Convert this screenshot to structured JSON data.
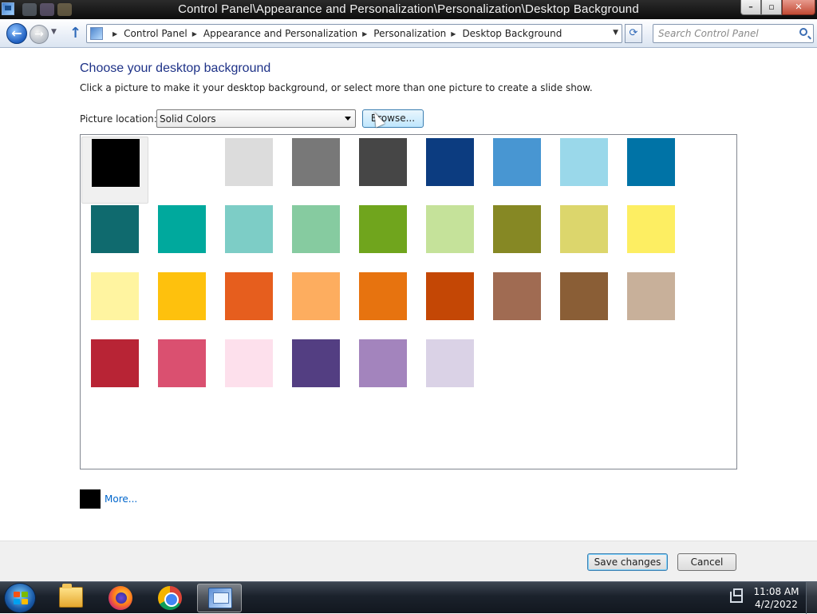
{
  "window": {
    "title": "Control Panel\\Appearance and Personalization\\Personalization\\Desktop Background",
    "controls": {
      "minimize": "–",
      "maximize": "▫",
      "close": "✕"
    }
  },
  "navbar": {
    "back_icon": "back-arrow-icon",
    "forward_icon": "forward-arrow-icon",
    "breadcrumbs": [
      "Control Panel",
      "Appearance and Personalization",
      "Personalization",
      "Desktop Background"
    ],
    "search_placeholder": "Search Control Panel"
  },
  "main": {
    "heading": "Choose your desktop background",
    "description": "Click a picture to make it your desktop background, or select more than one picture to create a slide show.",
    "picture_location_label": "Picture location:",
    "picture_location_value": "Solid Colors",
    "browse_label": "Browse...",
    "selected_index": 0,
    "colors": [
      "#000000",
      "#ffffff",
      "#dcdcdc",
      "#787878",
      "#464646",
      "#0c3c80",
      "#4896d2",
      "#9ad8ea",
      "#0073a6",
      "#0f6a6e",
      "#00a99d",
      "#7dcdc6",
      "#86cba0",
      "#70a51d",
      "#c5e29a",
      "#868824",
      "#dcd66c",
      "#fdee62",
      "#fff4a0",
      "#fec10d",
      "#e65e1e",
      "#fdad5f",
      "#e7730f",
      "#c44705",
      "#a06b52",
      "#8a5e36",
      "#c8b09a",
      "#b82435",
      "#da5070",
      "#fde0ec",
      "#533e82",
      "#a384bd",
      "#dad2e6"
    ],
    "more_swatch_color": "#000000",
    "more_label": "More..."
  },
  "footer": {
    "save_label": "Save changes",
    "cancel_label": "Cancel"
  },
  "taskbar": {
    "apps": [
      "windows-explorer",
      "firefox",
      "chrome",
      "control-panel"
    ],
    "time": "11:08 AM",
    "date": "4/2/2022"
  }
}
